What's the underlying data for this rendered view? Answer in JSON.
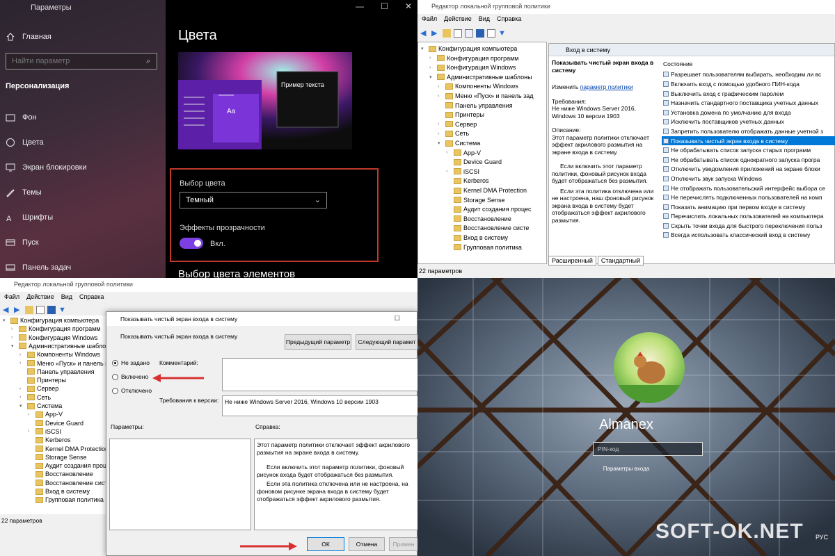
{
  "settings": {
    "window_title": "Параметры",
    "home": "Главная",
    "search_placeholder": "Найти параметр",
    "section": "Персонализация",
    "nav": [
      "Фон",
      "Цвета",
      "Экран блокировки",
      "Темы",
      "Шрифты",
      "Пуск",
      "Панель задач"
    ],
    "heading": "Цвета",
    "preview_text": "Пример текста",
    "preview_aa": "Aa",
    "color_choice_label": "Выбор цвета",
    "color_choice_value": "Темный",
    "transparency_label": "Эффекты прозрачности",
    "toggle_text": "Вкл.",
    "subheading": "Выбор цвета элементов"
  },
  "gpedit": {
    "title": "Редактор локальной групповой политики",
    "menu": [
      "Файл",
      "Действие",
      "Вид",
      "Справка"
    ],
    "tree": [
      "Конфигурация компьютера",
      "Конфигурация программ",
      "Конфигурация Windows",
      "Административные шаблоны",
      "Компоненты Windows",
      "Меню «Пуск» и панель зад",
      "Панель управления",
      "Принтеры",
      "Сервер",
      "Сеть",
      "Система",
      "App-V",
      "Device Guard",
      "iSCSI",
      "Kerberos",
      "Kernel DMA Protection",
      "Storage Sense",
      "Аудит создания процес",
      "Восстановление",
      "Восстановление систе",
      "Вход в систему",
      "Групповая политика"
    ],
    "folder_header": "Вход в систему",
    "desc_title": "Показывать чистый экран входа в систему",
    "desc_edit": "Изменить",
    "desc_link": "параметр политики",
    "desc_req_label": "Требования:",
    "desc_req": "Не ниже Windows Server 2016, Windows 10 версии 1903",
    "desc_label": "Описание:",
    "desc_text": "Этот параметр политики отключает эффект акрилового размытия на экране входа в систему.",
    "desc_p2": "Если включить этот параметр политики, фоновый рисунок входа будет отображаться без размытия.",
    "desc_p3": "Если эта политика отключена или не настроена, наш фоновый рисунок экрана входа в систему будет отображаться эффект акрилового размытия.",
    "list_header": "Состояние",
    "policies": [
      "Разрешает пользователям выбирать, необходим ли вс",
      "Включить вход с помощью удобного ПИН-кода",
      "Выключить вход с графическим паролем",
      "Назначить стандартного поставщика учетных данных",
      "Установка домена по умолчанию для входа",
      "Исключить поставщиков учетных данных",
      "Запретить пользователю отображать данные учетной з",
      "Показывать чистый экран входа в систему",
      "Не обрабатывать список запуска старых программ",
      "Не обрабатывать список однократного запуска програ",
      "Отключить уведомления приложений на экране блоки",
      "Отключить звук запуска Windows",
      "Не отображать пользовательский интерфейс выбора се",
      "Не перечислять подключенных пользователей на комп",
      "Показать анимацию при первом входе в систему",
      "Перечислить локальных пользователей на компьютера",
      "Скрыть точки входа для быстрого переключения польз",
      "Всегда использовать классический вход в систему"
    ],
    "selected_index": 7,
    "tabs": [
      "Расширенный",
      "Стандартный"
    ],
    "status": "22 параметров"
  },
  "dialog": {
    "title": "Показывать чистый экран входа в систему",
    "subtitle": "Показывать чистый экран входа в систему",
    "prev": "Предыдущий параметр",
    "next": "Следующий парамет",
    "opt_notset": "Не задано",
    "opt_on": "Включено",
    "opt_off": "Отключено",
    "comment": "Комментарий:",
    "req_label": "Требования к версии:",
    "req": "Не ниже Windows Server 2016, Windows 10 версии 1903",
    "params": "Параметры:",
    "help": "Справка:",
    "help_text1": "Этот параметр политики отключает эффект акрилового размытия на экране входа в систему.",
    "help_text2": "Если включить этот параметр политики, фоновый рисунок входа будет отображаться без размытия.",
    "help_text3": "Если эта политика отключена или не настроена, на фоновом рисунке экрана входа в систему будет отображаться эффект акрилового размытия.",
    "ok": "ОК",
    "cancel": "Отмена",
    "apply": "Примен"
  },
  "login": {
    "user": "Almanex",
    "pin_placeholder": "PIN-код",
    "pin_options": "Параметры входа",
    "watermark": "SOFT-OK.NET",
    "lang": "РУС"
  },
  "colors": {
    "accent": "#7b3fe4",
    "highlight_red": "#c0392b",
    "selection": "#0078d7"
  }
}
